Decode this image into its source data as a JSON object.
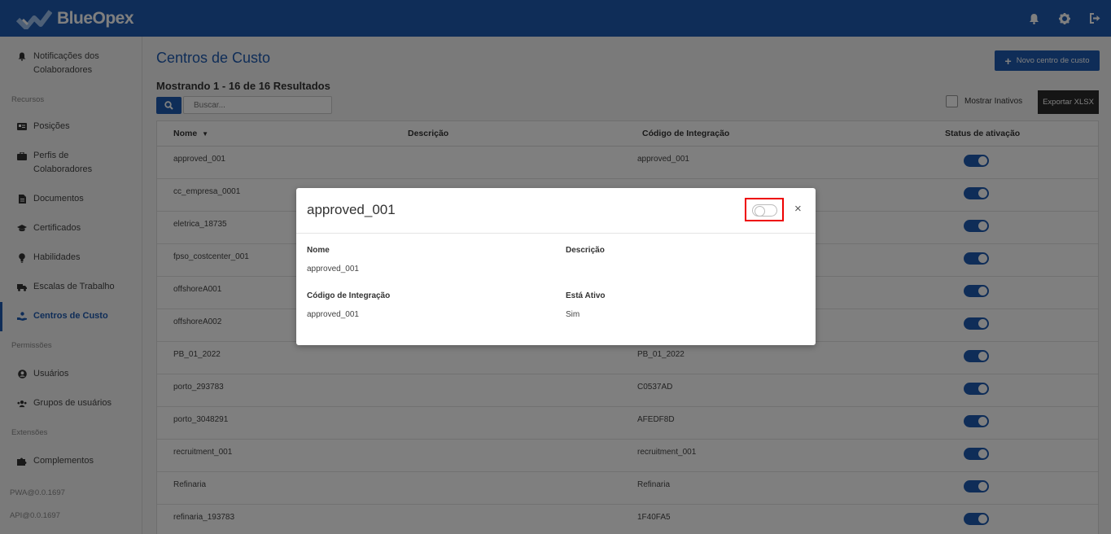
{
  "brand": {
    "name": "BlueOpex"
  },
  "colors": {
    "primary": "#1f5bb0",
    "dark_button": "#2b2b2b",
    "highlight": "#e00000"
  },
  "header": {
    "icons": [
      "bell-icon",
      "gear-icon",
      "logout-icon"
    ]
  },
  "sidebar": {
    "items": [
      {
        "label": "Notificações dos Colaboradores",
        "icon": "bell-icon"
      },
      {
        "label": "Posições",
        "icon": "id-card-icon"
      },
      {
        "label": "Perfis de Colaboradores",
        "icon": "briefcase-icon"
      },
      {
        "label": "Documentos",
        "icon": "document-icon"
      },
      {
        "label": "Certificados",
        "icon": "graduation-cap-icon"
      },
      {
        "label": "Habilidades",
        "icon": "lightbulb-icon"
      },
      {
        "label": "Escalas de Trabalho",
        "icon": "truck-icon"
      },
      {
        "label": "Centros de Custo",
        "icon": "hand-coin-icon"
      },
      {
        "label": "Usuários",
        "icon": "user-circle-icon"
      },
      {
        "label": "Grupos de usuários",
        "icon": "users-icon"
      },
      {
        "label": "Complementos",
        "icon": "puzzle-icon"
      }
    ],
    "sections": {
      "resources": "Recursos",
      "permissions": "Permissões",
      "extensions": "Extensões"
    },
    "versions": {
      "pwa": "PWA@0.0.1697",
      "api": "API@0.0.1697"
    }
  },
  "main": {
    "title": "Centros de Custo",
    "results": "Mostrando 1 - 16 de 16 Resultados",
    "search_placeholder": "Buscar...",
    "new_button": "Novo centro de custo",
    "show_inactive": "Mostrar Inativos",
    "export_button": "Exportar XLSX",
    "table": {
      "headers": {
        "name": "Nome",
        "description": "Descrição",
        "code": "Código de Integração",
        "status": "Status de ativação"
      },
      "rows": [
        {
          "name": "approved_001",
          "code": "approved_001"
        },
        {
          "name": "cc_empresa_0001",
          "code": ""
        },
        {
          "name": "eletrica_18735",
          "code": ""
        },
        {
          "name": "fpso_costcenter_001",
          "code": ""
        },
        {
          "name": "offshoreA001",
          "code": ""
        },
        {
          "name": "offshoreA002",
          "code": ""
        },
        {
          "name": "PB_01_2022",
          "code": "PB_01_2022"
        },
        {
          "name": "porto_293783",
          "code": "C0537AD"
        },
        {
          "name": "porto_3048291",
          "code": "AFEDF8D"
        },
        {
          "name": "recruitment_001",
          "code": "recruitment_001"
        },
        {
          "name": "Refinaria",
          "code": "Refinaria"
        },
        {
          "name": "refinaria_193783",
          "code": "1F40FA5"
        }
      ]
    }
  },
  "modal": {
    "title": "approved_001",
    "close": "×",
    "fields": {
      "name_label": "Nome",
      "name_value": "approved_001",
      "description_label": "Descrição",
      "code_label": "Código de Integração",
      "code_value": "approved_001",
      "active_label": "Está Ativo",
      "active_value": "Sim"
    }
  }
}
